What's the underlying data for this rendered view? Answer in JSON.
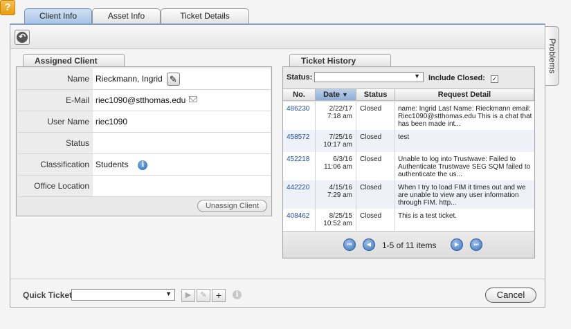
{
  "tabs": [
    {
      "label": "Client Info"
    },
    {
      "label": "Asset Info"
    },
    {
      "label": "Ticket Details"
    }
  ],
  "side_tab": {
    "label": "Problems"
  },
  "help": {
    "glyph": "?"
  },
  "assigned_client": {
    "header": "Assigned Client",
    "rows": [
      {
        "label": "Name",
        "value": "Rieckmann, Ingrid"
      },
      {
        "label": "E-Mail",
        "value": "riec1090@stthomas.edu"
      },
      {
        "label": "User Name",
        "value": "riec1090"
      },
      {
        "label": "Status",
        "value": ""
      },
      {
        "label": "Classification",
        "value": "Students"
      },
      {
        "label": "Office Location",
        "value": ""
      }
    ],
    "unassign_label": "Unassign Client"
  },
  "ticket_history": {
    "header": "Ticket History",
    "status_label": "Status:",
    "status_value": "",
    "include_closed_label": "Include Closed:",
    "include_closed_checked": true,
    "columns": [
      "No.",
      "Date",
      "Status",
      "Request Detail"
    ],
    "sorted_column": "Date",
    "rows": [
      {
        "no": "486230",
        "date": "2/22/17",
        "time": "7:18 am",
        "status": "Closed",
        "detail": "name: Ingrid Last Name: Rieckmann email: Riec1090@stthomas.edu This is a chat that has been made int..."
      },
      {
        "no": "458572",
        "date": "7/25/16",
        "time": "10:17 am",
        "status": "Closed",
        "detail": "test"
      },
      {
        "no": "452218",
        "date": "6/3/16",
        "time": "11:06 am",
        "status": "Closed",
        "detail": "Unable to log into Trustwave: Failed to Authenticate Trustwave SEG SQM failed to authenticate the us..."
      },
      {
        "no": "442220",
        "date": "4/15/16",
        "time": "7:29 am",
        "status": "Closed",
        "detail": "When I try to load FIM it times out and we are unable to view any user information through FIM. http..."
      },
      {
        "no": "408462",
        "date": "8/25/15",
        "time": "10:52 am",
        "status": "Closed",
        "detail": "This is a test ticket."
      }
    ],
    "pager_text": "1-5 of 11 items"
  },
  "footer": {
    "quick_ticket_label": "Quick Ticket",
    "quick_ticket_value": "",
    "cancel_label": "Cancel"
  },
  "colors": {
    "accent": "#7f9fc6",
    "link": "#1f4fa8",
    "help": "#e89b14"
  }
}
